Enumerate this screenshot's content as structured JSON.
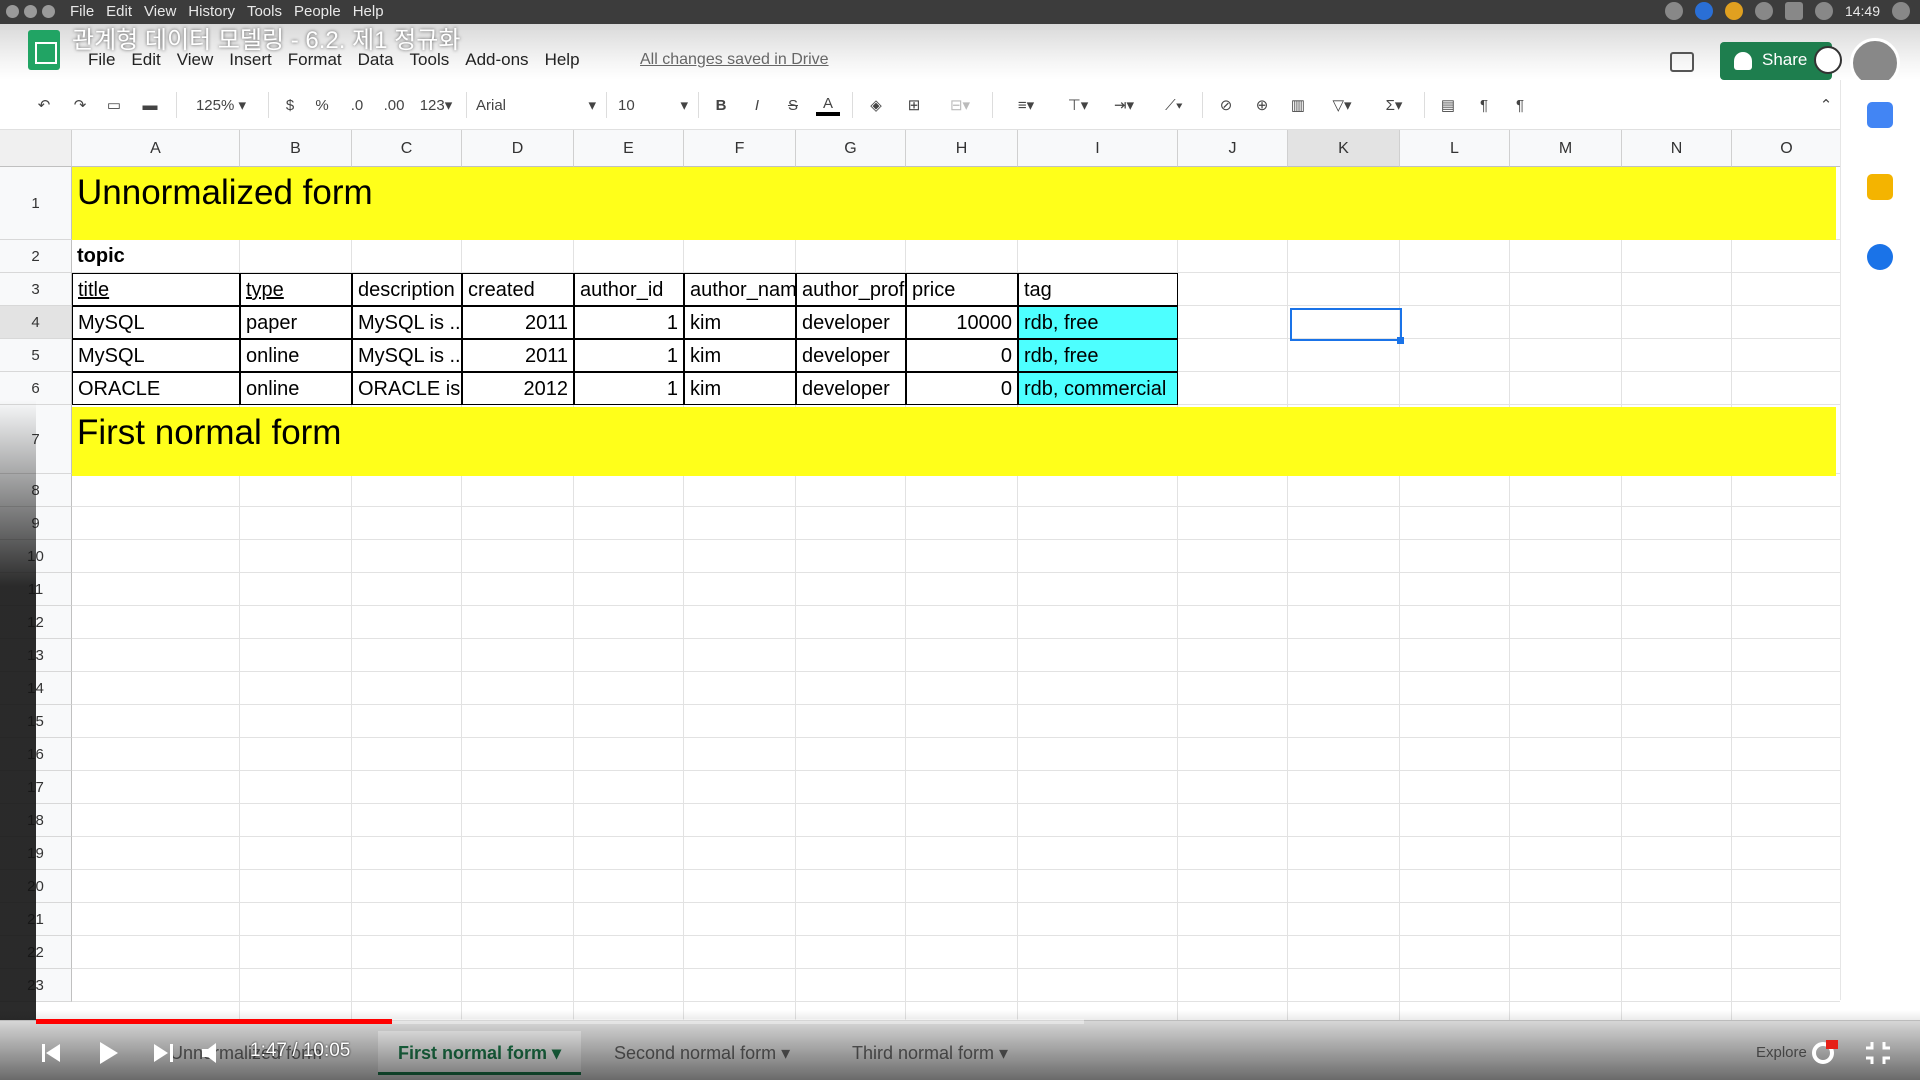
{
  "os_menu": [
    "File",
    "Edit",
    "View",
    "History",
    "Tools",
    "People",
    "Help"
  ],
  "os_clock": "14:49",
  "doc_title": "관계형 데이터 모델링 - 6.2. 제1 정규화",
  "app_menu": [
    "File",
    "Edit",
    "View",
    "Insert",
    "Format",
    "Data",
    "Tools",
    "Add-ons",
    "Help"
  ],
  "saved_status": "All changes saved in Drive",
  "share_label": "Share",
  "toolbar": {
    "zoom": "125%",
    "currency": "$",
    "percent": "%",
    "dec_less": ".0",
    "dec_more": ".00",
    "format_more": "123",
    "font": "Arial",
    "font_size": "10",
    "bold": "B",
    "italic": "I",
    "strike": "S",
    "text_color": "A",
    "sum": "Σ"
  },
  "columns": [
    "A",
    "B",
    "C",
    "D",
    "E",
    "F",
    "G",
    "H",
    "I",
    "J",
    "K",
    "L",
    "M",
    "N",
    "O"
  ],
  "rows": [
    "1",
    "2",
    "3",
    "4",
    "5",
    "6",
    "7",
    "8",
    "9",
    "10",
    "11",
    "12",
    "13",
    "14",
    "15",
    "16",
    "17",
    "18",
    "19",
    "20",
    "21",
    "22",
    "23"
  ],
  "banner1": "Unnormalized form",
  "topic_label": "topic",
  "table_headers": [
    "title",
    "type",
    "description",
    "created",
    "author_id",
    "author_nam",
    "author_prof",
    "price",
    "tag"
  ],
  "table_rows": [
    [
      "MySQL",
      "paper",
      "MySQL is ..",
      "2011",
      "1",
      "kim",
      "developer",
      "10000",
      "rdb, free"
    ],
    [
      "MySQL",
      "online",
      "MySQL is ..",
      "2011",
      "1",
      "kim",
      "developer",
      "0",
      "rdb, free"
    ],
    [
      "ORACLE",
      "online",
      "ORACLE is",
      "2012",
      "1",
      "kim",
      "developer",
      "0",
      "rdb, commercial"
    ]
  ],
  "banner2": "First normal form",
  "sheet_tabs": [
    "Unnormalized form",
    "First normal form",
    "Second normal form",
    "Third normal form"
  ],
  "active_tab": "First normal form",
  "explore_label": "Explore",
  "video": {
    "time": "1:47 / 10:05",
    "progress_fraction": 0.178
  },
  "colors": {
    "banner": "#ffff1a",
    "tag_cell": "#4dffff",
    "selection": "#1a73e8",
    "share": "#1e7e4e"
  }
}
